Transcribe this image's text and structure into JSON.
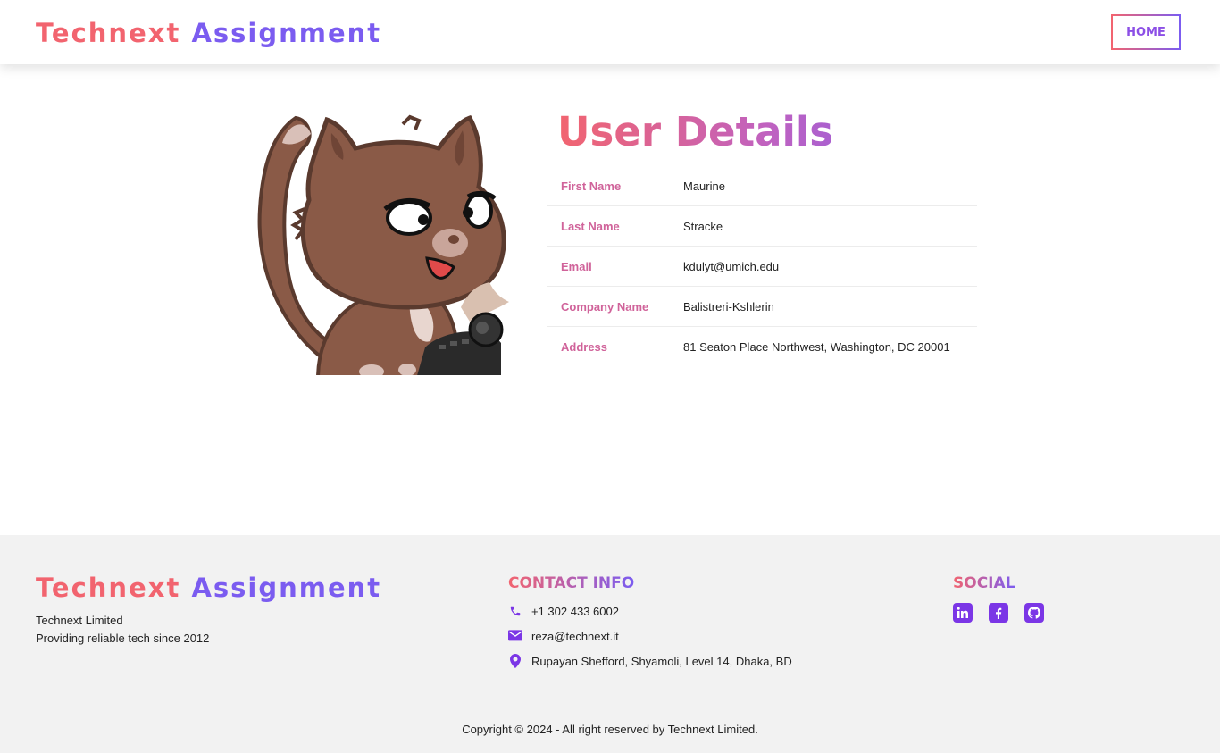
{
  "header": {
    "brand_part1": "Technext",
    "brand_part2": "Assignment",
    "home_label": "HOME"
  },
  "main": {
    "title": "User Details",
    "details": [
      {
        "label": "First Name",
        "value": "Maurine"
      },
      {
        "label": "Last Name",
        "value": "Stracke"
      },
      {
        "label": "Email",
        "value": "kdulyt@umich.edu"
      },
      {
        "label": "Company Name",
        "value": "Balistreri-Kshlerin"
      },
      {
        "label": "Address",
        "value": "81 Seaton Place Northwest, Washington, DC 20001"
      }
    ],
    "avatar_icon": "cat-typewriter-illustration"
  },
  "footer": {
    "brand_part1": "Technext",
    "brand_part2": "Assignment",
    "company_name": "Technext Limited",
    "tagline": "Providing reliable tech since 2012",
    "contact_title": "CONTACT INFO",
    "phone": "+1 302 433 6002",
    "email": "reza@technext.it",
    "address": "Rupayan Shefford, Shyamoli, Level 14, Dhaka, BD",
    "social_title": "SOCIAL",
    "social_icons": [
      "linkedin-icon",
      "facebook-icon",
      "github-icon"
    ],
    "copyright": "Copyright © 2024 - All right reserved by Technext Limited."
  },
  "colors": {
    "brand_pink": "#f2646f",
    "brand_purple": "#7b5cf0",
    "label_color": "#d0639a",
    "icon_purple": "#7b36e6",
    "footer_bg": "#f2f2f2"
  }
}
